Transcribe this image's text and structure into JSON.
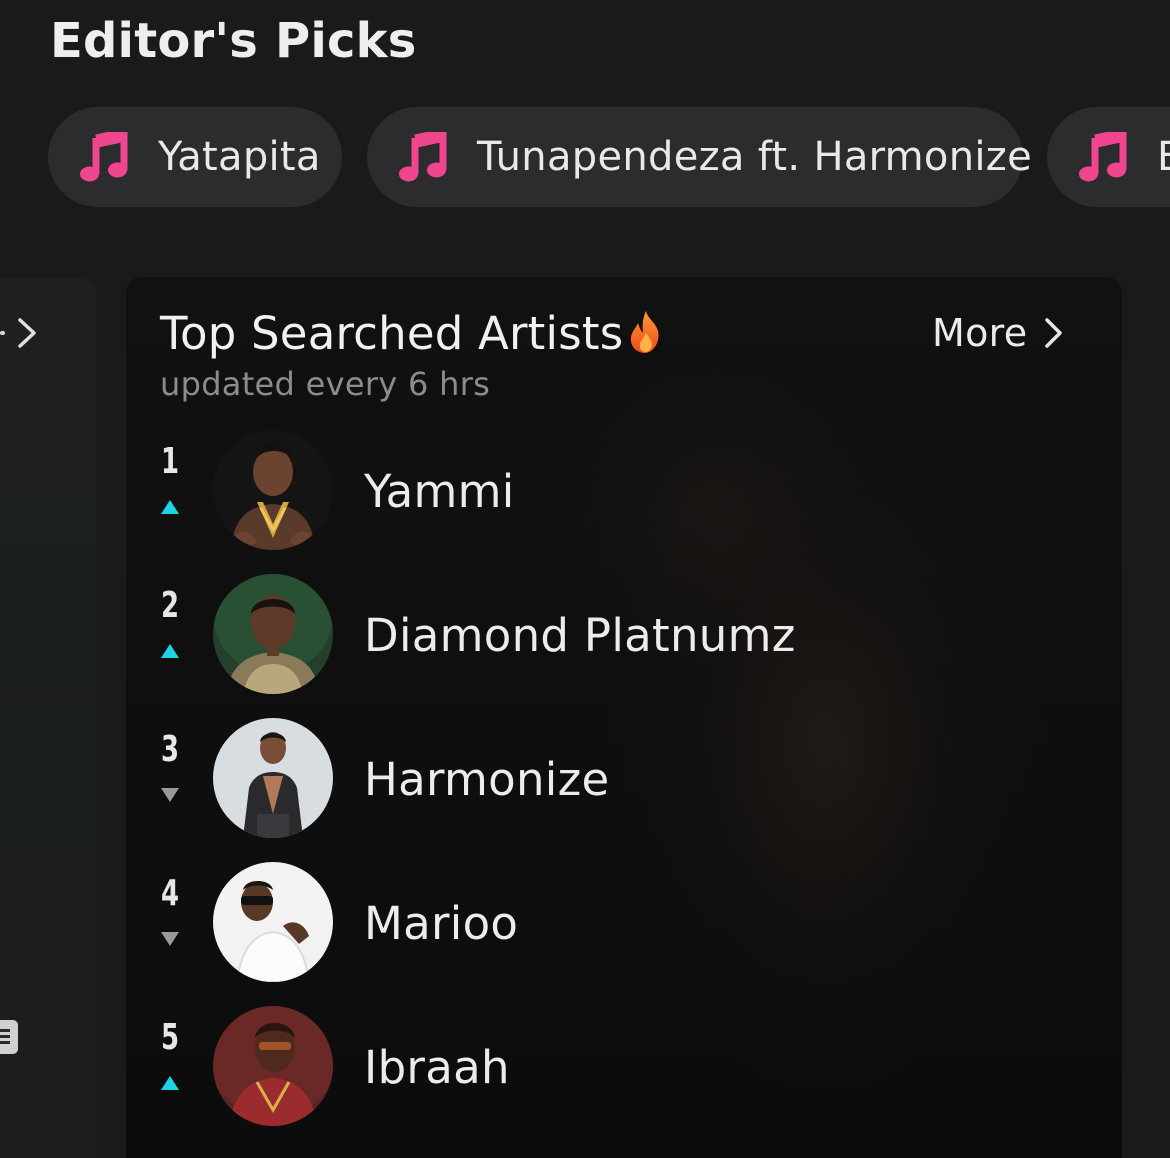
{
  "section": {
    "title": "Editor's Picks"
  },
  "chips": [
    {
      "label": "Yatapita",
      "icon": "music-note-icon"
    },
    {
      "label": "Tunapendeza ft. Harmonize",
      "icon": "music-note-icon"
    },
    {
      "label": "B",
      "icon": "music-note-icon"
    }
  ],
  "card": {
    "title": "Top Searched Artists",
    "title_icon": "fire-icon",
    "subtitle": "updated every 6 hrs",
    "more_label": "More",
    "more_icon": "chevron-right-icon"
  },
  "artists": [
    {
      "rank": "1",
      "name": "Yammi",
      "trend": "up"
    },
    {
      "rank": "2",
      "name": "Diamond Platnumz",
      "trend": "up"
    },
    {
      "rank": "3",
      "name": "Harmonize",
      "trend": "down"
    },
    {
      "rank": "4",
      "name": "Marioo",
      "trend": "down"
    },
    {
      "rank": "5",
      "name": "Ibraah",
      "trend": "up"
    }
  ],
  "colors": {
    "background": "#1a1a1b",
    "chip_background": "#2c2c2e",
    "card_background": "#0e0e0e",
    "music_note": "#f0458f",
    "trend_up": "#1fd2e6",
    "trend_down": "#9a9a9a",
    "subtitle": "#8c8c8c"
  }
}
